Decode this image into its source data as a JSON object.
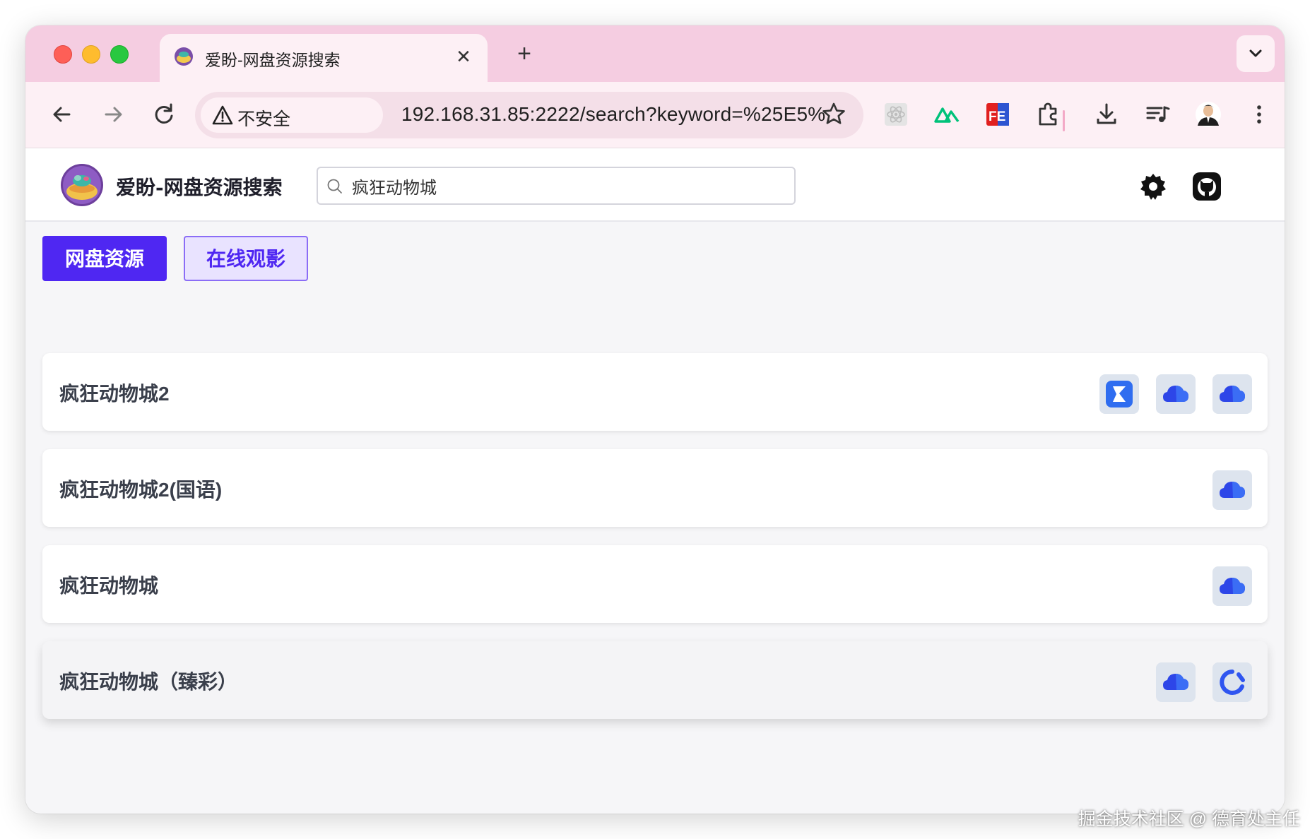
{
  "browser": {
    "tab_title": "爱盼-网盘资源搜索",
    "tab_close": "✕",
    "new_tab": "+",
    "security_label": "不安全",
    "url": "192.168.31.85:2222/search?keyword=%25E5%..."
  },
  "site": {
    "title": "爱盼-网盘资源搜索",
    "search_value": "疯狂动物城"
  },
  "tabs": [
    {
      "label": "网盘资源",
      "active": true
    },
    {
      "label": "在线观影",
      "active": false
    }
  ],
  "results": [
    {
      "title": "疯狂动物城2",
      "links": [
        "quark",
        "baidu",
        "baidu"
      ]
    },
    {
      "title": "疯狂动物城2(国语)",
      "links": [
        "baidu"
      ]
    },
    {
      "title": "疯狂动物城",
      "links": [
        "baidu"
      ]
    },
    {
      "title": "疯狂动物城（臻彩）",
      "links": [
        "baidu",
        "aliyun"
      ]
    }
  ],
  "colors": {
    "tab_strip": "#f5cde1",
    "accent": "#4f27f2",
    "accent_light": "#e9e3ff"
  },
  "icons": {
    "quark": "quark-pan-icon",
    "baidu": "cloud-pan-icon",
    "aliyun": "aliyun-pan-icon"
  },
  "watermark": "掘金技术社区 @ 德育处主任"
}
